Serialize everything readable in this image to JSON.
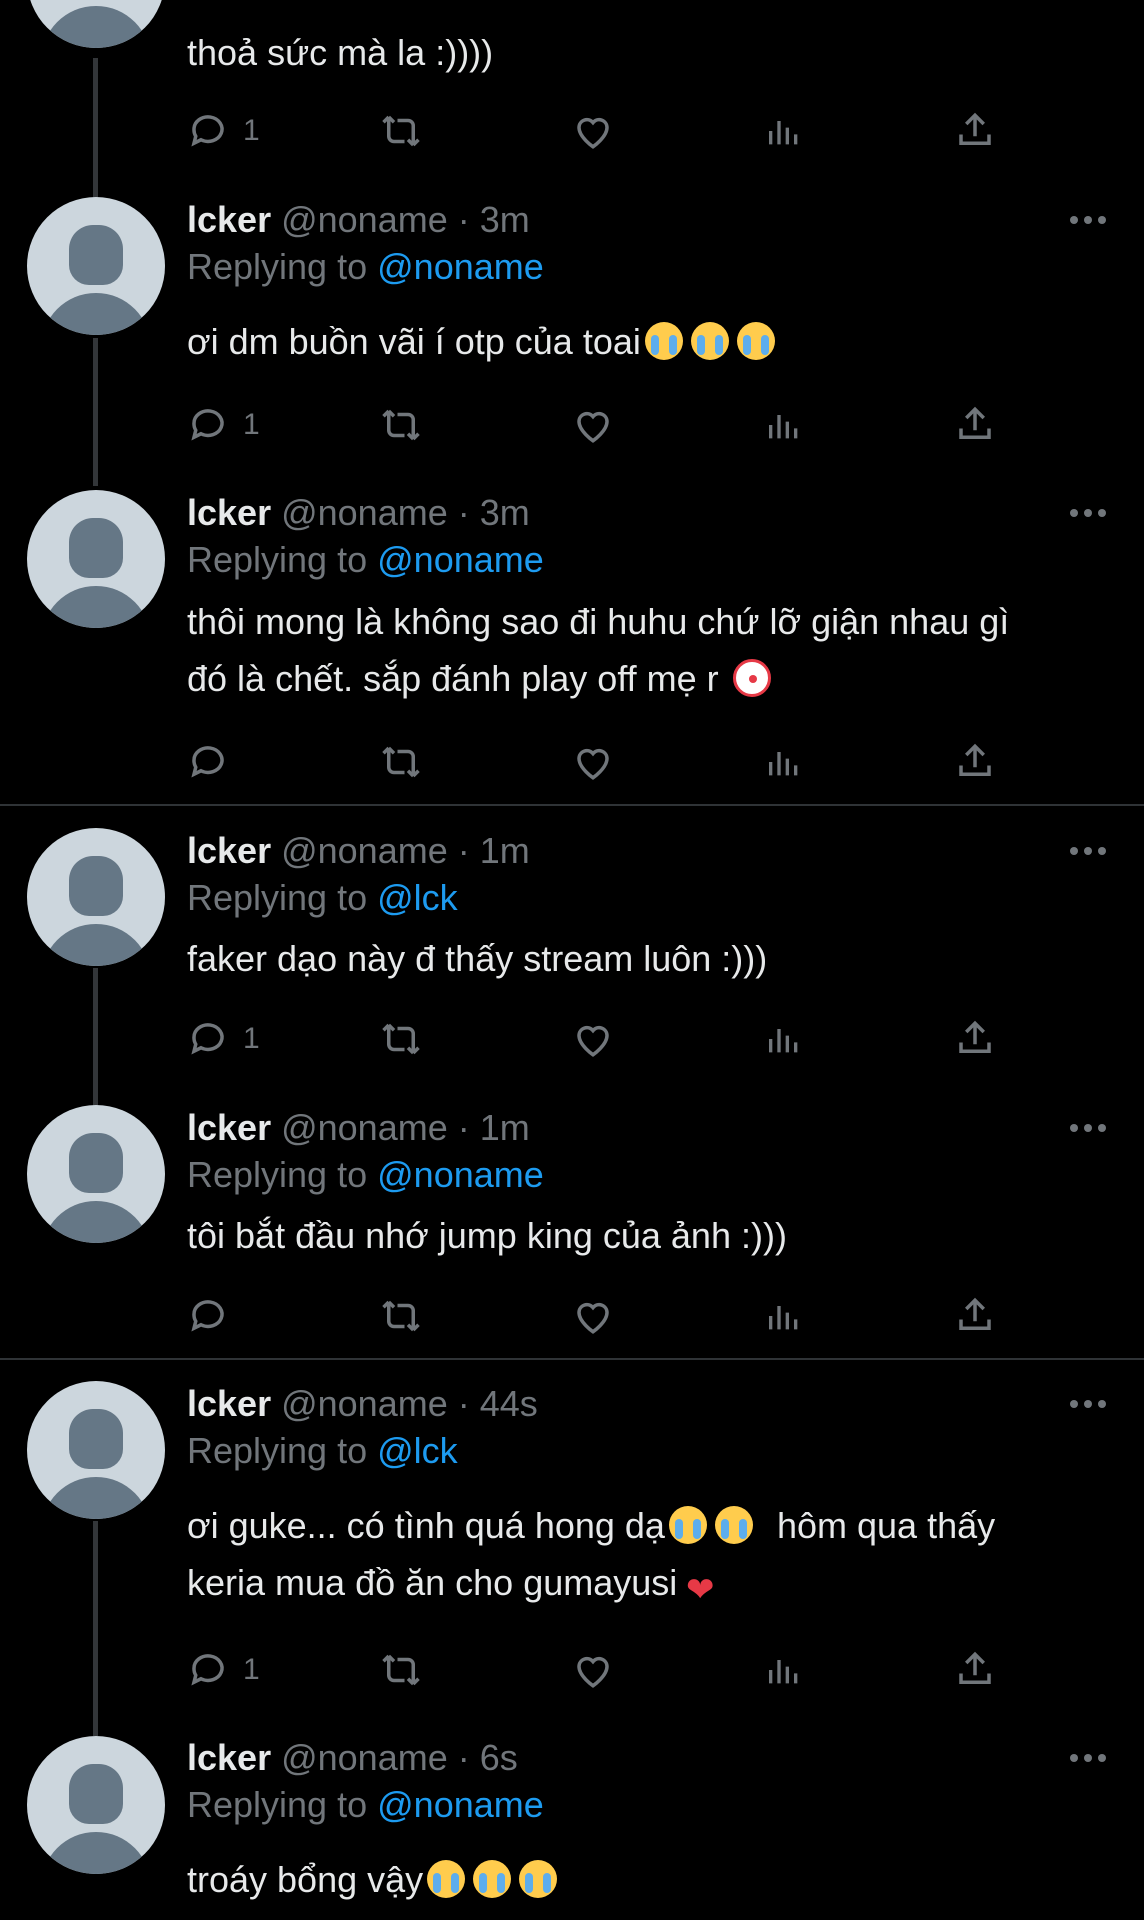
{
  "top": {
    "text": "thoả sức mà la :))))",
    "reply_count": "1"
  },
  "tweets": [
    {
      "name": "lcker",
      "handle": "@noname",
      "dot": "·",
      "time": "3m",
      "replying_prefix": "Replying to",
      "replying_to": "@noname",
      "text": [
        "ơi dm buồn vãi í otp của toai"
      ],
      "emoji": [
        "crying-face-emoji",
        "crying-face-emoji",
        "crying-face-emoji"
      ],
      "reply_count": "1"
    },
    {
      "name": "lcker",
      "handle": "@noname",
      "dot": "·",
      "time": "3m",
      "replying_prefix": "Replying to",
      "replying_to": "@noname",
      "text": [
        "thôi mong là không sao đi huhu chứ lỡ giận nhau gì",
        "đó là chết. sắp đánh play off mẹ r"
      ],
      "emoji": [
        "clown-face-emoji"
      ],
      "reply_count": ""
    },
    {
      "name": "lcker",
      "handle": "@noname",
      "dot": "·",
      "time": "1m",
      "replying_prefix": "Replying to",
      "replying_to": "@lck",
      "text": [
        "faker dạo này đ thấy stream luôn :)))"
      ],
      "reply_count": "1"
    },
    {
      "name": "lcker",
      "handle": "@noname",
      "dot": "·",
      "time": "1m",
      "replying_prefix": "Replying to",
      "replying_to": "@noname",
      "text": [
        "tôi bắt đầu nhớ jump king của ảnh :)))"
      ],
      "reply_count": ""
    },
    {
      "name": "lcker",
      "handle": "@noname",
      "dot": "·",
      "time": "44s",
      "replying_prefix": "Replying to",
      "replying_to": "@lck",
      "text": [
        "ơi guke... có tình quá hong dạ",
        "hôm qua thấy",
        "keria mua đồ ăn cho gumayusi"
      ],
      "emoji": [
        "crying-face-emoji",
        "crying-face-emoji",
        "heart-on-fire-emoji"
      ],
      "reply_count": "1"
    },
    {
      "name": "lcker",
      "handle": "@noname",
      "dot": "·",
      "time": "6s",
      "replying_prefix": "Replying to",
      "replying_to": "@noname",
      "text": [
        "troáy bổng vậy"
      ],
      "emoji": [
        "crying-face-emoji",
        "crying-face-emoji",
        "crying-face-emoji"
      ],
      "reply_count": ""
    }
  ],
  "colors": {
    "background": "#000000",
    "primary_text": "#e7e9ea",
    "secondary_text": "#71767b",
    "link": "#1d9bf0",
    "avatar_bg": "#ccd6dd",
    "avatar_fg": "#657786"
  }
}
